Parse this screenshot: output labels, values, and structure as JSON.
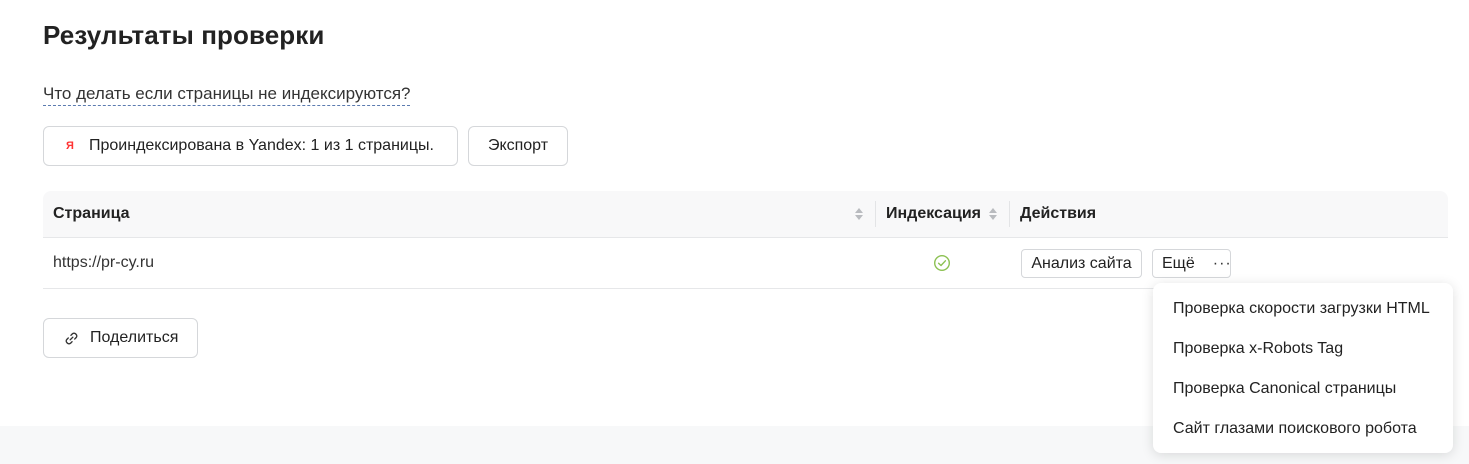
{
  "title": "Результаты проверки",
  "help_link": "Что делать если страницы не индексируются?",
  "buttons": {
    "indexed_icon": "Я",
    "indexed_label": "Проиндексирована в Yandex: 1 из 1 страницы.",
    "export_label": "Экспорт",
    "share_label": "Поделиться"
  },
  "table": {
    "columns": [
      "Страница",
      "Индексация",
      "Действия"
    ],
    "rows": [
      {
        "url": "https://pr-cy.ru",
        "indexed": true,
        "analysis_label": "Анализ сайта",
        "more_label": "Ещё",
        "more_dots": "···"
      }
    ]
  },
  "dropdown": {
    "items": [
      "Проверка скорости загрузки HTML",
      "Проверка x-Robots Tag",
      "Проверка Canonical страницы",
      "Сайт глазами поискового робота"
    ]
  },
  "colors": {
    "yandex_icon": "#ff3333",
    "check_icon": "#8cc152",
    "link_underline": "#5b7bb0"
  },
  "icons": {
    "indexed_status": "check-circle-icon",
    "sort": "sort-icon",
    "share": "link-icon"
  }
}
